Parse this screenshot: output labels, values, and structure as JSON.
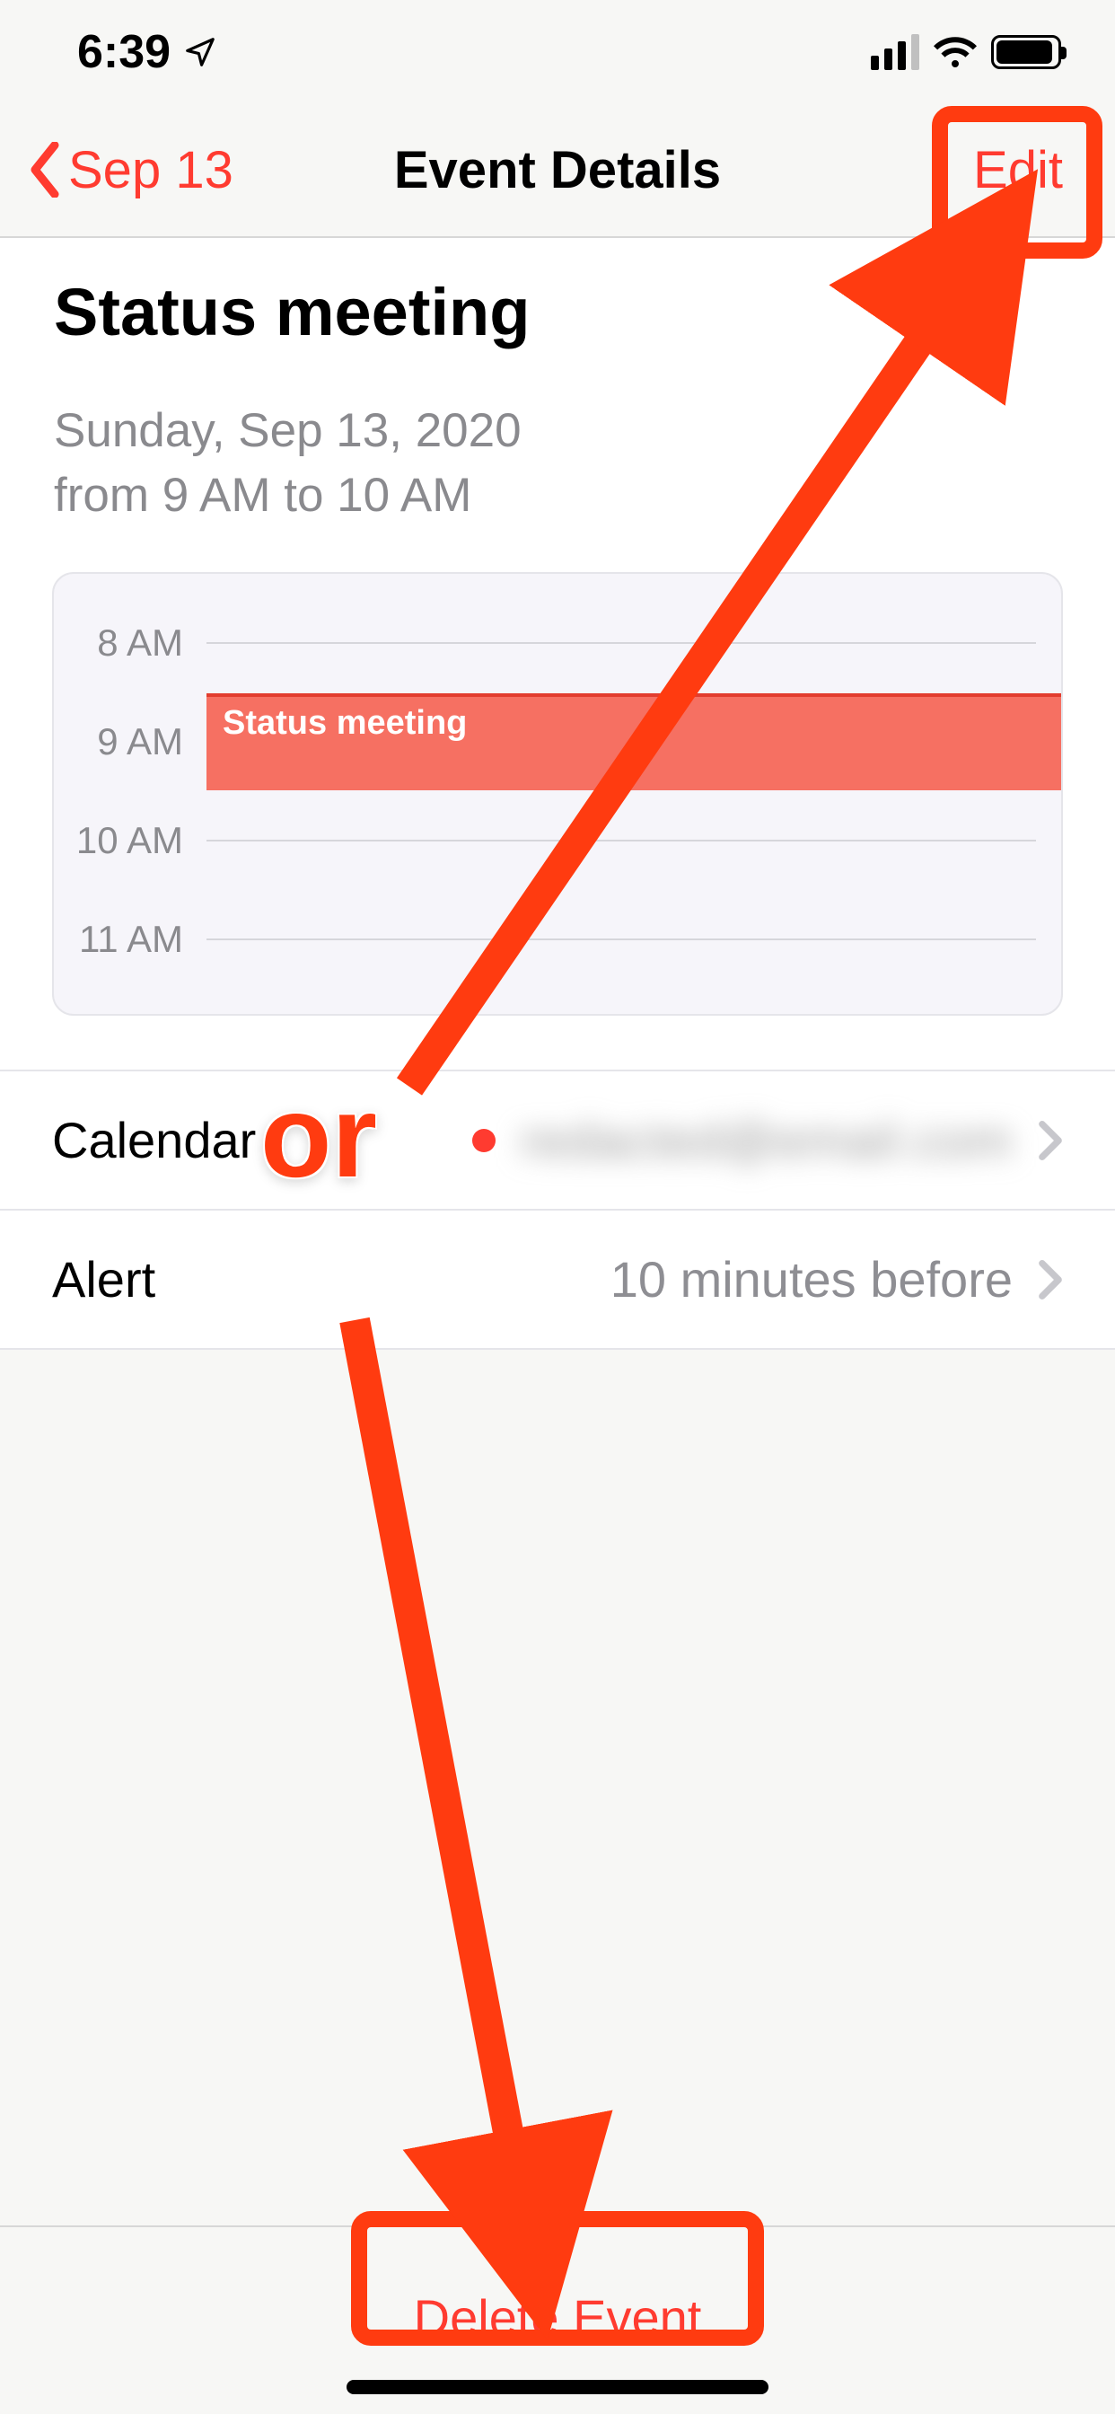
{
  "status_bar": {
    "time": "6:39"
  },
  "nav": {
    "back_label": "Sep 13",
    "title": "Event Details",
    "edit_label": "Edit"
  },
  "event": {
    "title": "Status meeting",
    "date_line": "Sunday, Sep 13, 2020",
    "time_line": "from 9 AM to 10 AM"
  },
  "timeline": {
    "hours": [
      "8 AM",
      "9 AM",
      "10 AM",
      "11 AM"
    ],
    "block_label": "Status meeting"
  },
  "rows": {
    "calendar": {
      "label": "Calendar",
      "value": "redacted@email.com"
    },
    "alert": {
      "label": "Alert",
      "value": "10 minutes before"
    }
  },
  "bottom": {
    "delete_label": "Delete Event"
  },
  "annotation": {
    "or": "or"
  }
}
